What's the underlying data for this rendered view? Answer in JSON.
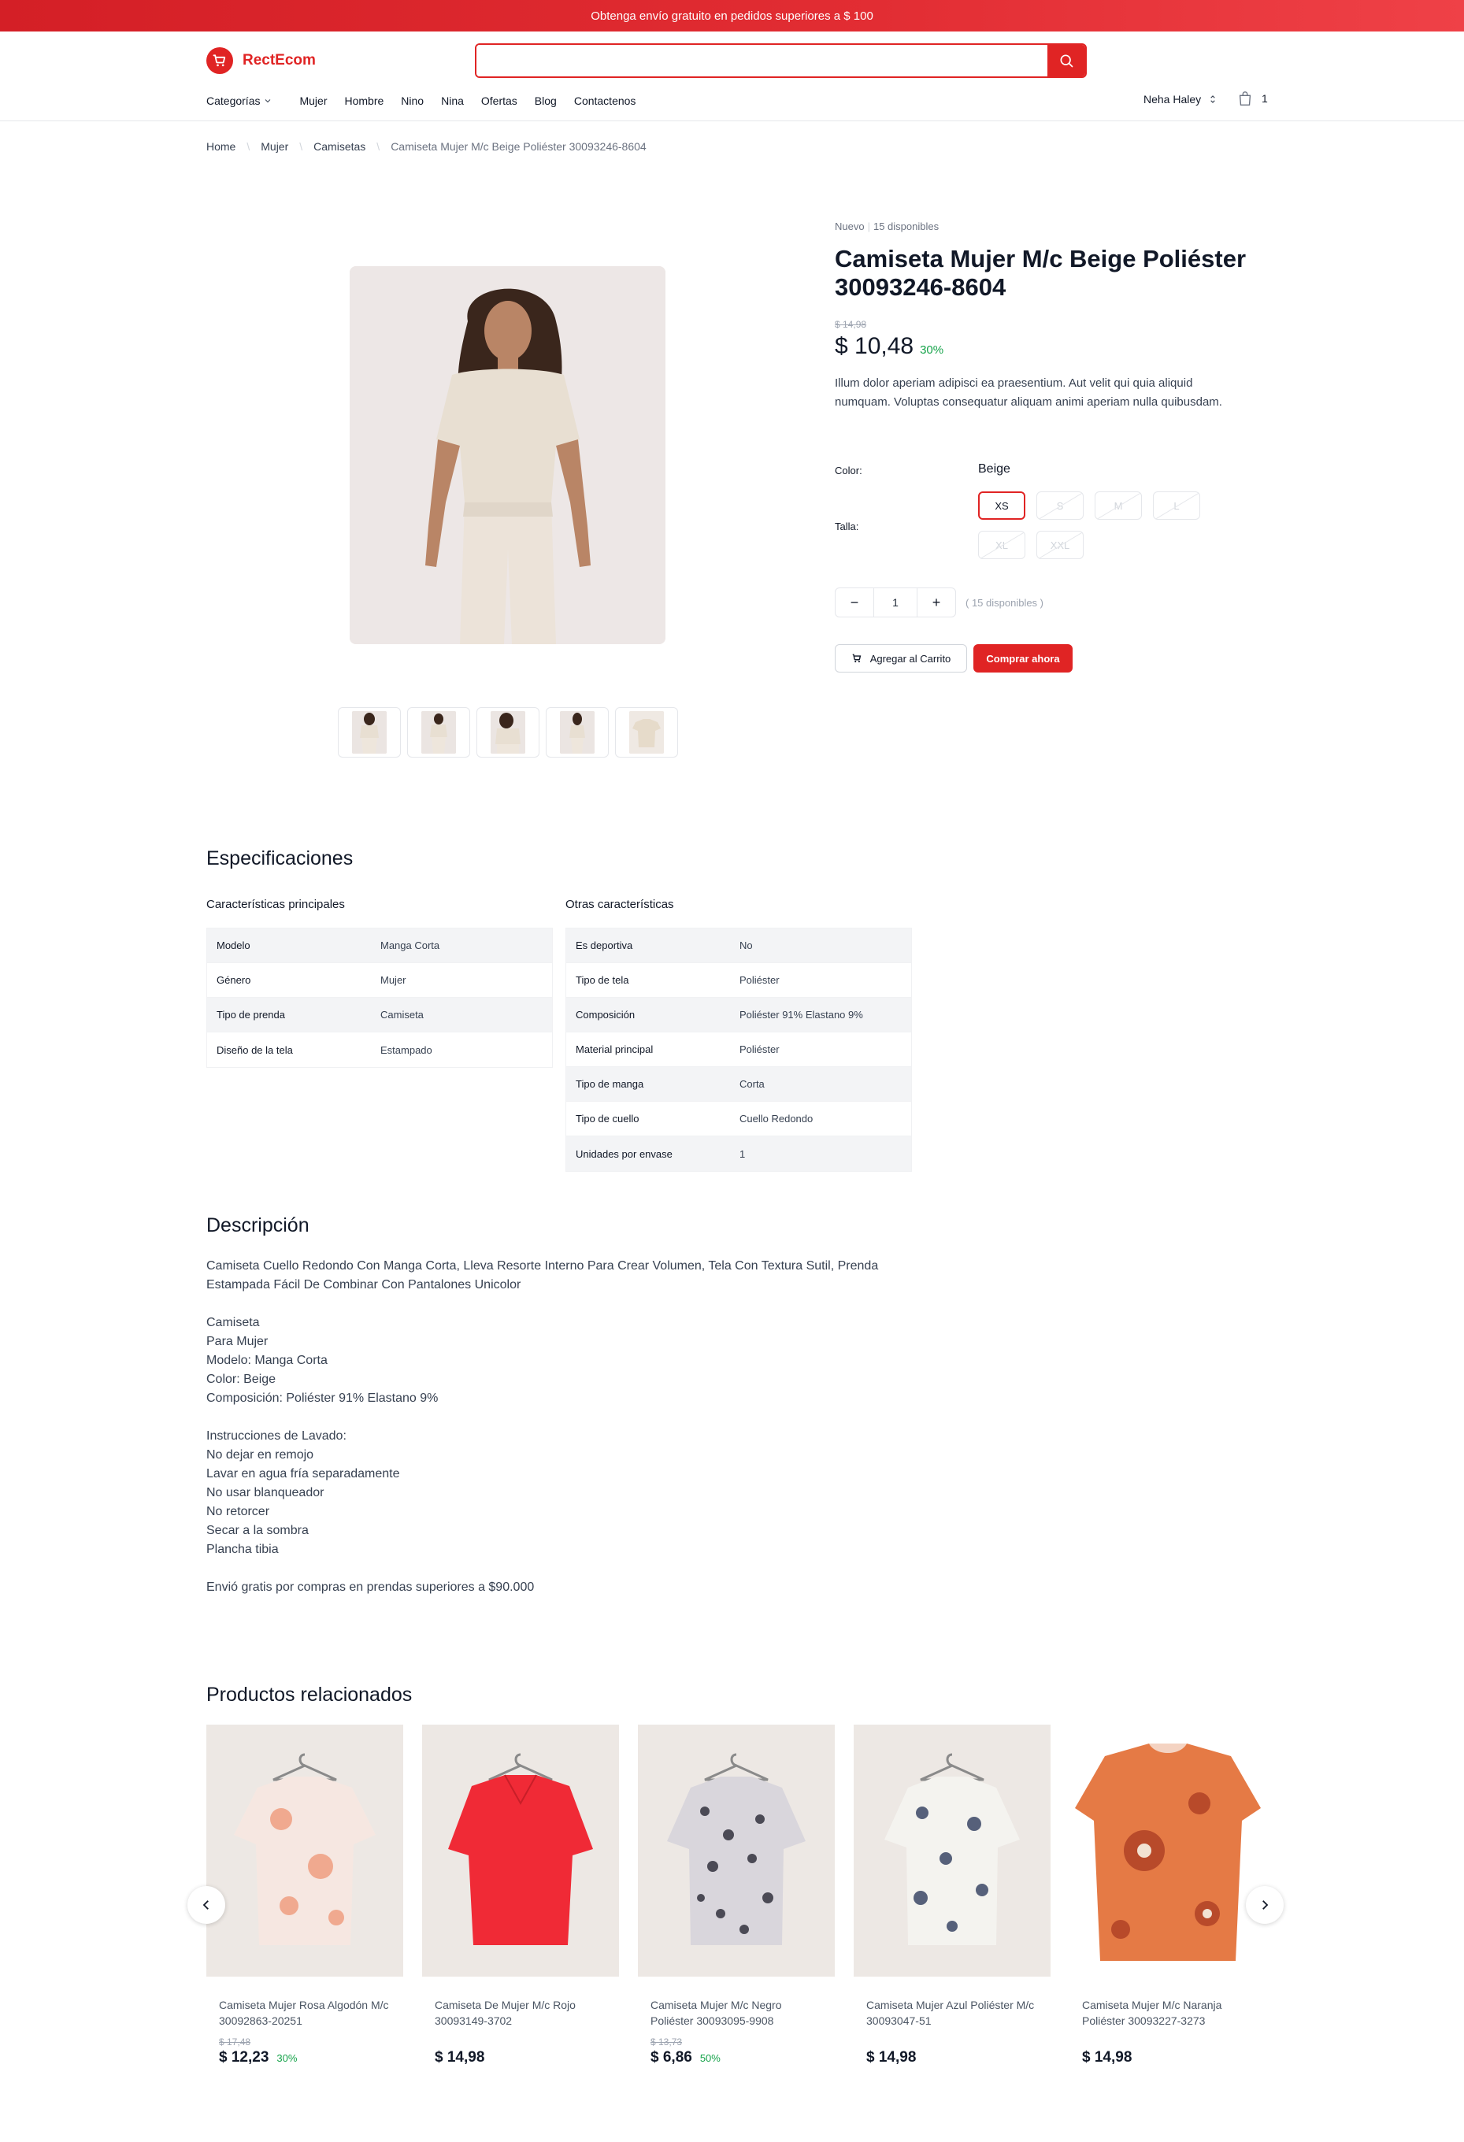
{
  "promo": {
    "text": "Obtenga envío gratuito en pedidos superiores a $ 100"
  },
  "header": {
    "brand": "RectEcom",
    "search_placeholder": "",
    "nav": [
      "Categorías",
      "Mujer",
      "Hombre",
      "Nino",
      "Nina",
      "Ofertas",
      "Blog",
      "Contactenos"
    ],
    "user_name": "Neha Haley",
    "cart_count": "1"
  },
  "breadcrumb": [
    "Home",
    "Mujer",
    "Camisetas",
    "Camiseta Mujer M/c Beige Poliéster 30093246-8604"
  ],
  "product": {
    "condition": "Nuevo",
    "stock_label": "15 disponibles",
    "title": "Camiseta Mujer M/c Beige Poliéster 30093246-8604",
    "old_price": "$ 14,98",
    "price": "$ 10,48",
    "discount": "30%",
    "short_description": "Illum dolor aperiam adipisci ea praesentium. Aut velit qui quia aliquid numquam. Voluptas consequatur aliquam animi aperiam nulla quibusdam.",
    "color_label": "Color:",
    "color_value": "Beige",
    "size_label": "Talla:",
    "sizes": [
      {
        "label": "XS",
        "state": "active"
      },
      {
        "label": "S",
        "state": "disabled"
      },
      {
        "label": "M",
        "state": "disabled"
      },
      {
        "label": "L",
        "state": "disabled"
      },
      {
        "label": "XL",
        "state": "disabled"
      },
      {
        "label": "XXL",
        "state": "disabled"
      }
    ],
    "quantity": "1",
    "availability": "( 15 disponibles )",
    "add_to_cart": "Agregar al Carrito",
    "buy_now": "Comprar ahora",
    "thumbnail_count": 5
  },
  "specs": {
    "title": "Especificaciones",
    "main_title": "Características principales",
    "main": [
      [
        "Modelo",
        "Manga Corta"
      ],
      [
        "Género",
        "Mujer"
      ],
      [
        "Tipo de prenda",
        "Camiseta"
      ],
      [
        "Diseño de la tela",
        "Estampado"
      ]
    ],
    "other_title": "Otras características",
    "other": [
      [
        "Es deportiva",
        "No"
      ],
      [
        "Tipo de tela",
        "Poliéster"
      ],
      [
        "Composición",
        "Poliéster 91% Elastano 9%"
      ],
      [
        "Material principal",
        "Poliéster"
      ],
      [
        "Tipo de manga",
        "Corta"
      ],
      [
        "Tipo de cuello",
        "Cuello Redondo"
      ],
      [
        "Unidades por envase",
        "1"
      ]
    ]
  },
  "description": {
    "title": "Descripción",
    "body": "Camiseta Cuello Redondo Con Manga Corta, Lleva Resorte Interno Para Crear Volumen, Tela Con Textura Sutil, Prenda Estampada Fácil De Combinar Con Pantalones Unicolor\n\nCamiseta\nPara Mujer\nModelo: Manga Corta\nColor: Beige\nComposición: Poliéster 91% Elastano 9%\n\nInstrucciones de Lavado:\nNo dejar en remojo\nLavar en agua fría separadamente\nNo usar blanqueador\nNo retorcer\nSecar a la sombra\nPlancha tibia\n\nEnvió gratis por compras en prendas superiores a $90.000"
  },
  "related": {
    "title": "Productos relacionados",
    "items": [
      {
        "name": "Camiseta Mujer Rosa Algodón M/c 30092863-20251",
        "old_price": "$ 17,48",
        "price": "$ 12,23",
        "discount": "30%",
        "color": "#f2c5b4"
      },
      {
        "name": "Camiseta De Mujer M/c Rojo 30093149-3702",
        "old_price": "",
        "price": "$ 14,98",
        "discount": "",
        "color": "#f02a36"
      },
      {
        "name": "Camiseta Mujer M/c Negro Poliéster 30093095-9908",
        "old_price": "$ 13,73",
        "price": "$ 6,86",
        "discount": "50%",
        "color": "#6b6a74"
      },
      {
        "name": "Camiseta Mujer Azul Poliéster M/c 30093047-51",
        "old_price": "",
        "price": "$ 14,98",
        "discount": "",
        "color": "#c9ccd6"
      },
      {
        "name": "Camiseta Mujer M/c Naranja Poliéster 30093227-3273",
        "old_price": "",
        "price": "$ 14,98",
        "discount": "",
        "color": "#e57a45"
      }
    ]
  },
  "colors": {
    "accent": "#e02424",
    "discount": "#16a34a"
  }
}
